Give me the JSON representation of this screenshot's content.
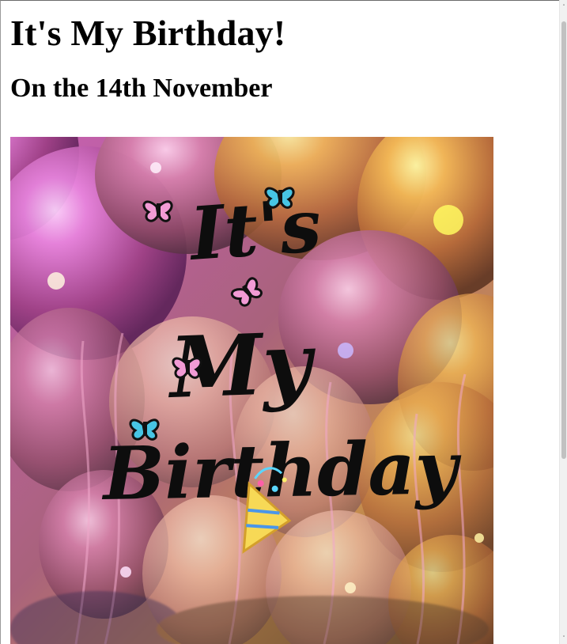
{
  "page": {
    "title": "It's My Birthday!",
    "subtitle": "On the 14th November"
  },
  "image": {
    "overlay_text": [
      "It's",
      "My",
      "Birthday"
    ]
  },
  "icons": {
    "scroll_up": "chevron-up-icon",
    "scroll_down": "chevron-down-icon",
    "butterfly": "butterfly-icon",
    "party_popper": "party-popper-icon"
  },
  "colors": {
    "text": "#000000",
    "background": "#ffffff",
    "scrollbar_track": "#f1f1f1",
    "scrollbar_thumb": "#c1c1c1",
    "butterfly_blue": "#47c5e4",
    "butterfly_pink": "#f29bd5",
    "confetti_yellow": "#f7d956"
  },
  "scrollbar": {
    "up_glyph": "˄",
    "down_glyph": "˅"
  }
}
